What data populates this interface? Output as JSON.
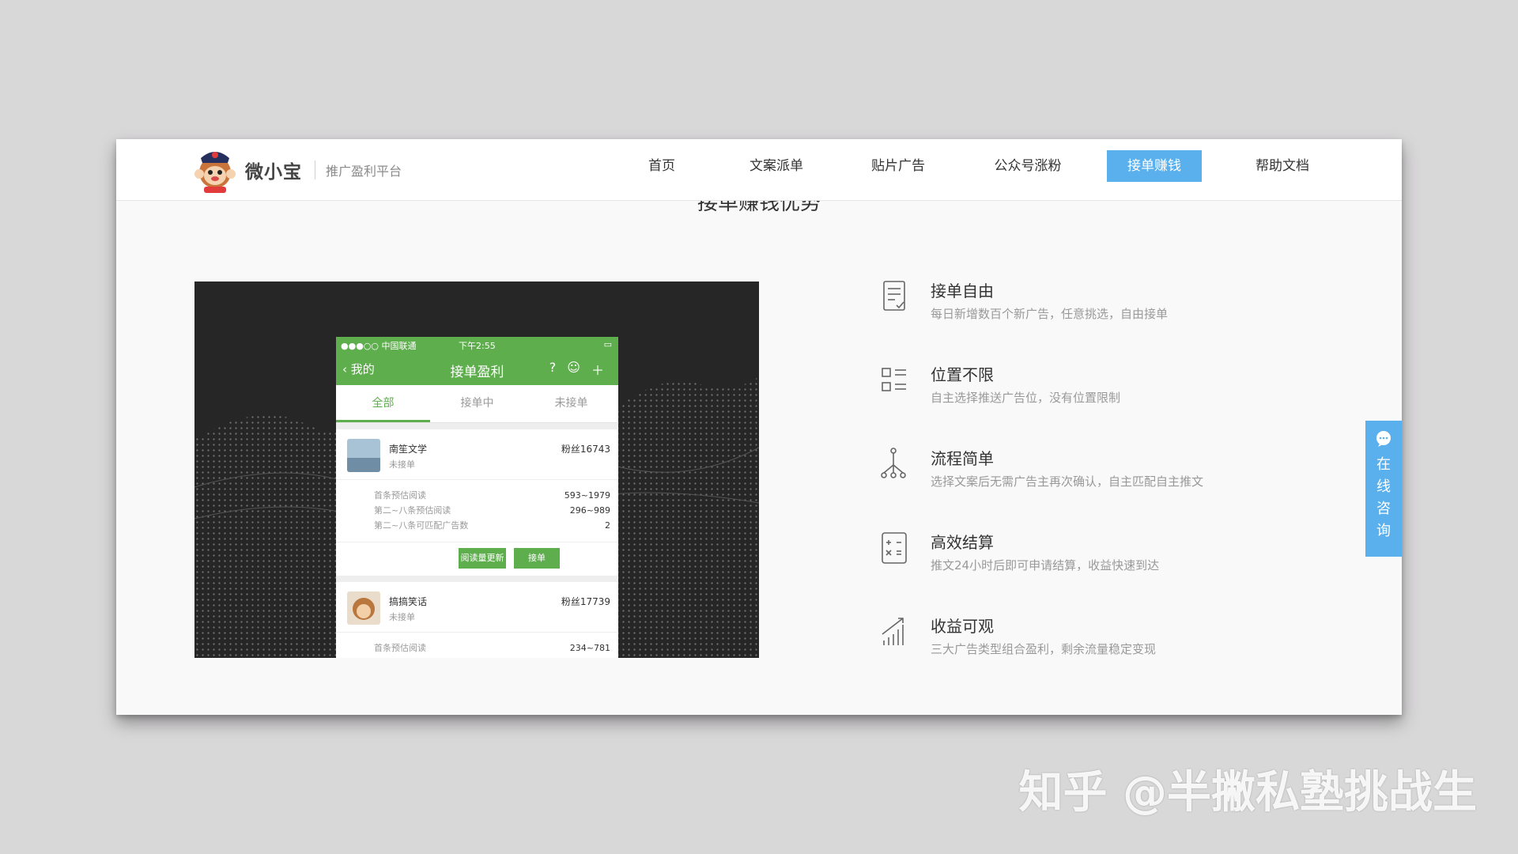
{
  "header": {
    "brand": "微小宝",
    "slogan": "推广盈利平台",
    "nav": [
      {
        "label": "首页"
      },
      {
        "label": "文案派单"
      },
      {
        "label": "贴片广告"
      },
      {
        "label": "公众号涨粉"
      },
      {
        "label": "接单赚钱",
        "active": true
      },
      {
        "label": "帮助文档"
      }
    ]
  },
  "section_title": "接单赚钱优势",
  "phone": {
    "status": {
      "carrier": "●●●○○ 中国联通",
      "time": "下午2:55"
    },
    "back_label": "我的",
    "title": "接单盈利",
    "tabs": [
      "全部",
      "接单中",
      "未接单"
    ],
    "cards": [
      {
        "name": "南笙文学",
        "state": "未接单",
        "fans": "粉丝16743",
        "stats": [
          {
            "label": "首条预估阅读",
            "value": "593~1979"
          },
          {
            "label": "第二~八条预估阅读",
            "value": "296~989"
          },
          {
            "label": "第二~八条可匹配广告数",
            "value": "2"
          }
        ],
        "btn_update": "阅读量更新",
        "btn_accept": "接单"
      },
      {
        "name": "搞搞笑话",
        "state": "未接单",
        "fans": "粉丝17739",
        "stats": [
          {
            "label": "首条预估阅读",
            "value": "234~781"
          }
        ]
      }
    ]
  },
  "features": [
    {
      "icon": "document-check-icon",
      "title": "接单自由",
      "desc": "每日新增数百个新广告，任意挑选，自由接单"
    },
    {
      "icon": "list-icon",
      "title": "位置不限",
      "desc": "自主选择推送广告位，没有位置限制"
    },
    {
      "icon": "flow-icon",
      "title": "流程简单",
      "desc": "选择文案后无需广告主再次确认，自主匹配自主推文"
    },
    {
      "icon": "calculator-icon",
      "title": "高效结算",
      "desc": "推文24小时后即可申请结算，收益快速到达"
    },
    {
      "icon": "growth-chart-icon",
      "title": "收益可观",
      "desc": "三大广告类型组合盈利，剩余流量稳定变现"
    }
  ],
  "consult_label": "在线咨询",
  "watermark": "知乎 @半撇私塾挑战生",
  "colors": {
    "accent_blue": "#5ab0ec",
    "wechat_green": "#5fae4e"
  }
}
